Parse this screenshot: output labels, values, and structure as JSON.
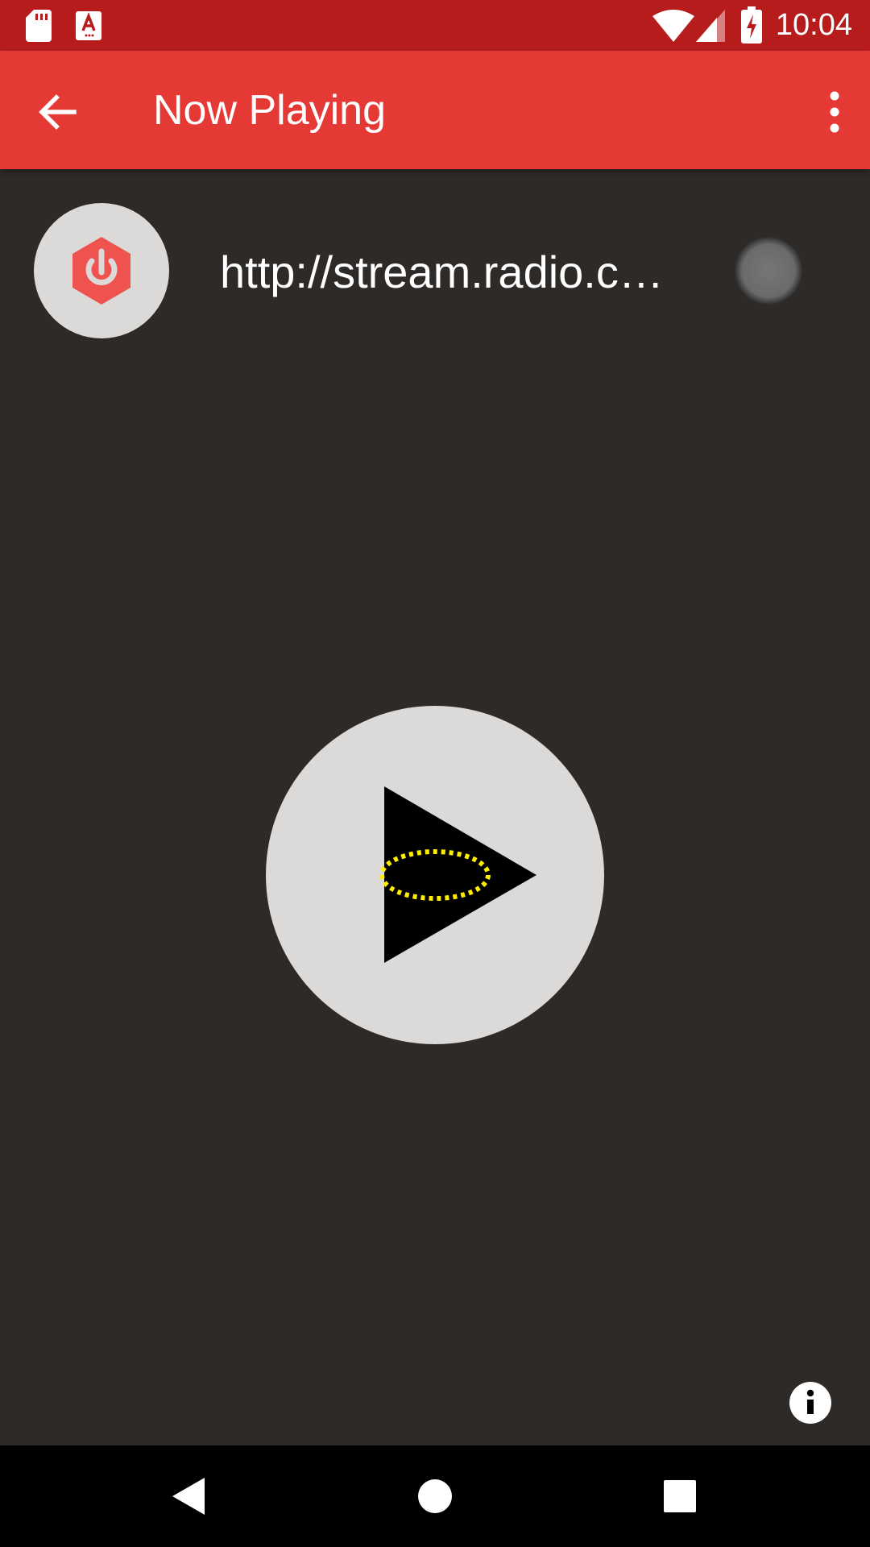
{
  "status_bar": {
    "time": "10:04",
    "icons": [
      "sd-card-icon",
      "font-download-icon",
      "wifi-icon",
      "signal-icon",
      "battery-charging-icon"
    ]
  },
  "app_bar": {
    "title": "Now Playing",
    "back_icon": "arrow-back-icon",
    "menu_icon": "more-vert-icon"
  },
  "station": {
    "logo_icon": "power-hexagon-icon",
    "url": "http://stream.radio.c…",
    "status_indicator": "grey"
  },
  "player": {
    "play_icon": "play-icon"
  },
  "info_icon": "info-icon",
  "nav_bar": {
    "icons": [
      "nav-back-icon",
      "nav-home-icon",
      "nav-recents-icon"
    ]
  },
  "colors": {
    "status_bar": "#b71c1c",
    "app_bar": "#e53935",
    "background": "#2d2a28",
    "accent": "#e53935",
    "button_bg": "#dbdad9"
  }
}
